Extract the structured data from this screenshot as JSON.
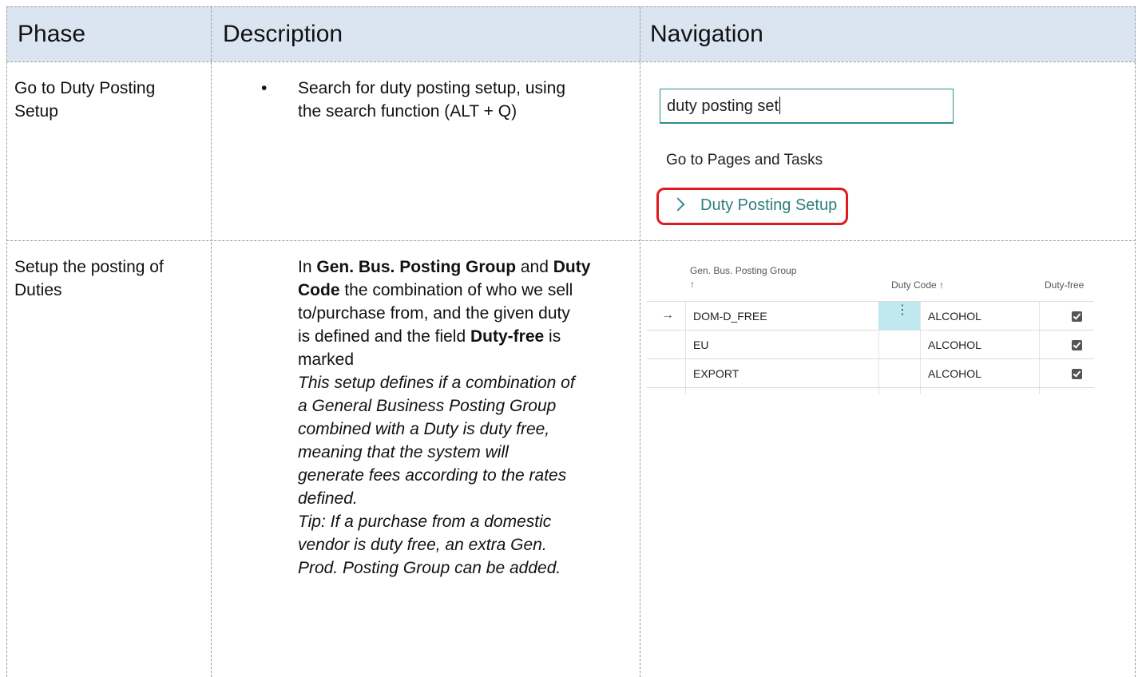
{
  "table": {
    "headers": [
      "Phase",
      "Description",
      "Navigation"
    ],
    "rows": [
      {
        "phase": [
          "Go to Duty Posting",
          "Setup"
        ],
        "bullet": "•",
        "description": [
          "Search for duty posting setup, using",
          "the search function (ALT + Q)"
        ]
      },
      {
        "phase": [
          "Setup the posting of",
          "Duties"
        ],
        "description_runs": {
          "l1a": "In ",
          "l1b": "Gen. Bus. Posting Group",
          "l1c": " and ",
          "l1d": "Duty",
          "l2a": "Code",
          "l2b": " the combination of who we sell",
          "l3": "to/purchase from, and the given duty",
          "l4a": "is defined and the field ",
          "l4b": "Duty-free",
          "l4c": " is",
          "l5": "marked"
        },
        "italic_lines": [
          "This setup defines if a combination of",
          "a General Business Posting Group",
          "combined with a Duty is duty free,",
          "meaning that the system will",
          "generate fees according to the rates",
          "defined.",
          "Tip: If a purchase from a domestic",
          "vendor is duty free, an extra Gen.",
          "Prod. Posting Group can be added."
        ]
      }
    ]
  },
  "nav1": {
    "search_value": "duty posting set",
    "section_label": "Go to Pages and Tasks",
    "result_label": "Duty Posting Setup"
  },
  "nav2": {
    "col_gen_bus": "Gen. Bus. Posting Group",
    "col_gen_bus_arrow": "↑",
    "col_duty_code": "Duty Code ↑",
    "col_duty_free": "Duty-free",
    "rows": [
      {
        "group": "DOM-D_FREE",
        "code": "ALCOHOL",
        "duty_free": true
      },
      {
        "group": "EU",
        "code": "ALCOHOL",
        "duty_free": true
      },
      {
        "group": "EXPORT",
        "code": "ALCOHOL",
        "duty_free": true
      }
    ],
    "row_arrow": "→",
    "dots": "⋮"
  },
  "colors": {
    "header_band": "#dbe5f1",
    "highlight_border": "#e0191e",
    "accent": "#2a8f8f",
    "selected_cell": "#bfe9ef"
  }
}
